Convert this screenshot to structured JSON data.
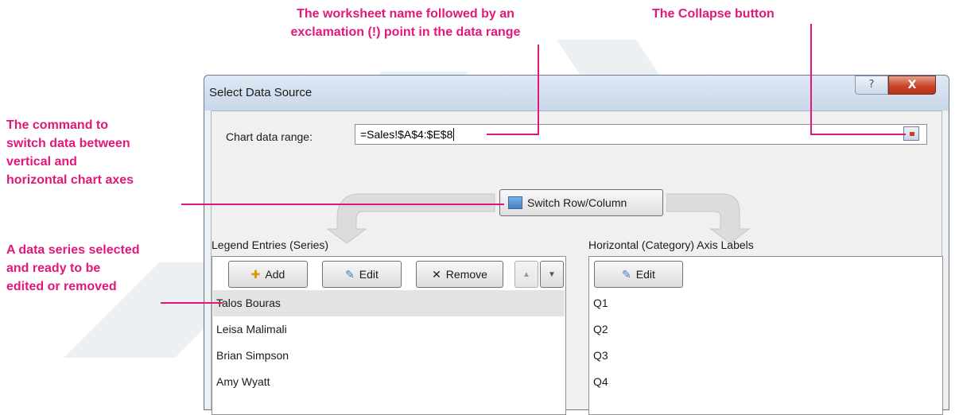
{
  "callouts": {
    "worksheet_name": [
      "The worksheet name followed by an",
      "exclamation (!) point in the data range"
    ],
    "collapse_button": "The Collapse button",
    "switch_command": [
      "The command to",
      "switch data between",
      "vertical and",
      "horizontal chart axes"
    ],
    "series_selected": [
      "A data series selected",
      "and ready to be",
      "edited or removed"
    ]
  },
  "dialog": {
    "title": "Select Data Source",
    "help_glyph": "?",
    "close_glyph": "X",
    "range_label": "Chart data range:",
    "range_value": "=Sales!$A$4:$E$8",
    "switch_label": "Switch Row/Column",
    "legend_label": "Legend Entries (Series)",
    "axis_label": "Horizontal (Category) Axis Labels",
    "legend_buttons": {
      "add": "Add",
      "edit": "Edit",
      "remove": "Remove",
      "up_glyph": "▲",
      "down_glyph": "▼"
    },
    "axis_buttons": {
      "edit": "Edit"
    },
    "series": [
      "Talos Bouras",
      "Leisa Malimali",
      "Brian Simpson",
      "Amy Wyatt"
    ],
    "categories": [
      "Q1",
      "Q2",
      "Q3",
      "Q4"
    ]
  },
  "colors": {
    "callout": "#e2177a",
    "close_button": "#c9442a"
  }
}
